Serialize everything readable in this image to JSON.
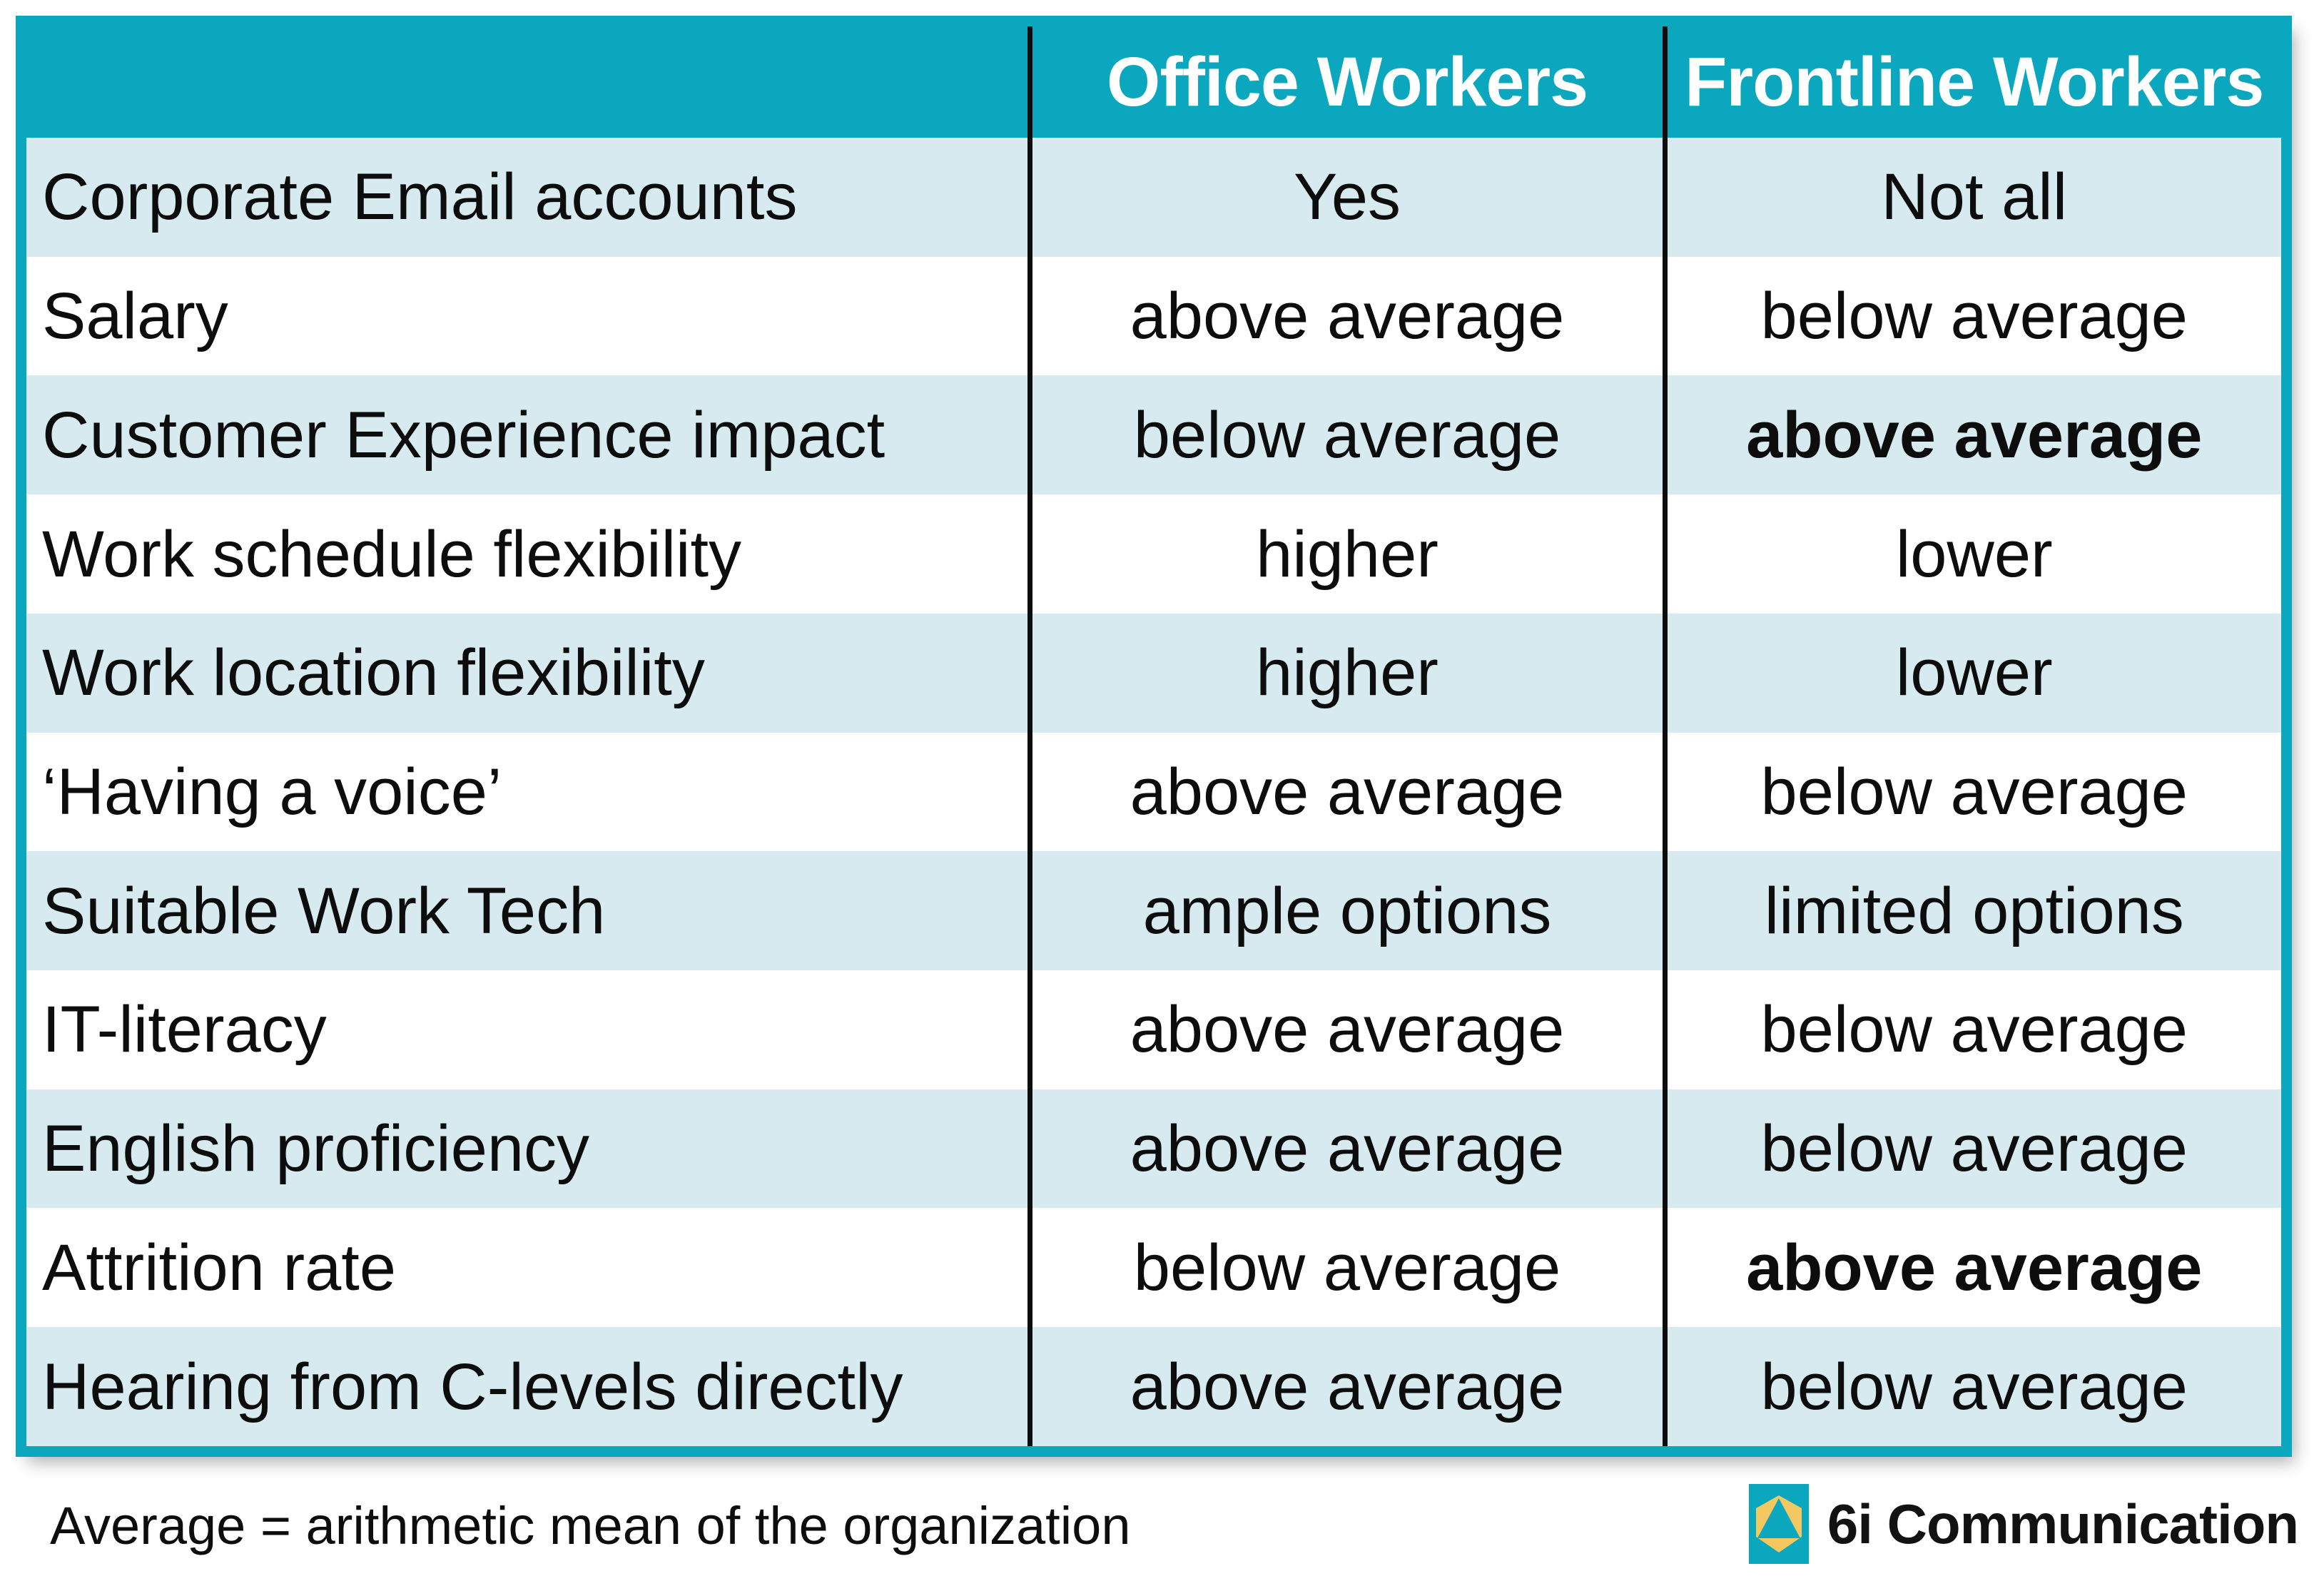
{
  "colors": {
    "accent_teal": "#0aa7bf",
    "row_shade": "#d6eaef",
    "row_plain": "#ffffff",
    "text": "#0d0d0d",
    "header_text": "#ffffff",
    "logo_gold": "#f4c860"
  },
  "table": {
    "columns": [
      {
        "label": "",
        "align": "left"
      },
      {
        "label": "Office Workers",
        "align": "center"
      },
      {
        "label": "Frontline Workers",
        "align": "center"
      }
    ],
    "rows": [
      {
        "label": "Corporate Email accounts",
        "office": "Yes",
        "frontline": "Not all",
        "office_bold": false,
        "frontline_bold": false,
        "shaded": true
      },
      {
        "label": "Salary",
        "office": "above average",
        "frontline": "below average",
        "office_bold": false,
        "frontline_bold": false,
        "shaded": false
      },
      {
        "label": "Customer Experience impact",
        "office": "below average",
        "frontline": "above average",
        "office_bold": false,
        "frontline_bold": true,
        "shaded": true
      },
      {
        "label": "Work schedule flexibility",
        "office": "higher",
        "frontline": "lower",
        "office_bold": false,
        "frontline_bold": false,
        "shaded": false
      },
      {
        "label": "Work location flexibility",
        "office": "higher",
        "frontline": "lower",
        "office_bold": false,
        "frontline_bold": false,
        "shaded": true
      },
      {
        "label": "‘Having a voice’",
        "office": "above average",
        "frontline": "below average",
        "office_bold": false,
        "frontline_bold": false,
        "shaded": false
      },
      {
        "label": "Suitable Work Tech",
        "office": "ample options",
        "frontline": "limited options",
        "office_bold": false,
        "frontline_bold": false,
        "shaded": true
      },
      {
        "label": "IT-literacy",
        "office": "above average",
        "frontline": "below average",
        "office_bold": false,
        "frontline_bold": false,
        "shaded": false
      },
      {
        "label": "English proficiency",
        "office": "above average",
        "frontline": "below average",
        "office_bold": false,
        "frontline_bold": false,
        "shaded": true
      },
      {
        "label": "Attrition rate",
        "office": "below average",
        "frontline": "above average",
        "office_bold": false,
        "frontline_bold": true,
        "shaded": false
      },
      {
        "label": "Hearing from C-levels directly",
        "office": "above average",
        "frontline": "below average",
        "office_bold": false,
        "frontline_bold": false,
        "shaded": true
      }
    ]
  },
  "footer": {
    "note": "Average = arithmetic mean of the organization",
    "brand_name": "6i Communication",
    "brand_icon": "hexagon-triangle-logo-icon"
  }
}
